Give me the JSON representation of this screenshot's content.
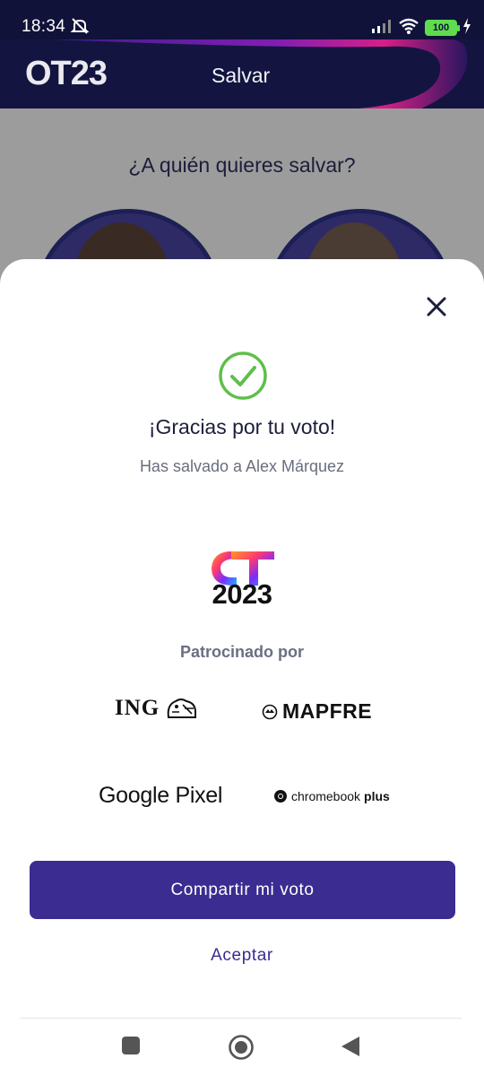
{
  "status_bar": {
    "time": "18:34",
    "battery": "100"
  },
  "app_header": {
    "logo": "OT23",
    "title": "Salvar"
  },
  "background": {
    "question": "¿A quién quieres salvar?"
  },
  "sheet": {
    "title": "¡Gracias por tu voto!",
    "subtitle": "Has salvado a Alex Márquez",
    "logo_year": "2023",
    "sponsored_by": "Patrocinado por",
    "sponsors": {
      "ing": "ING",
      "mapfre": "MAPFRE",
      "google_pixel": "Google Pixel",
      "chromebook_pre": "chromebook",
      "chromebook_post": "plus"
    },
    "share_button": "Compartir mi voto",
    "accept_button": "Aceptar"
  },
  "colors": {
    "primary": "#3a2c91",
    "success": "#5fbf4a",
    "header_bg": "#131540",
    "title_text": "#1c1f3a"
  },
  "icons": {
    "close": "close-icon",
    "success": "check-circle-icon",
    "nav_recent": "square-icon",
    "nav_home": "circle-icon",
    "nav_back": "triangle-back-icon"
  }
}
